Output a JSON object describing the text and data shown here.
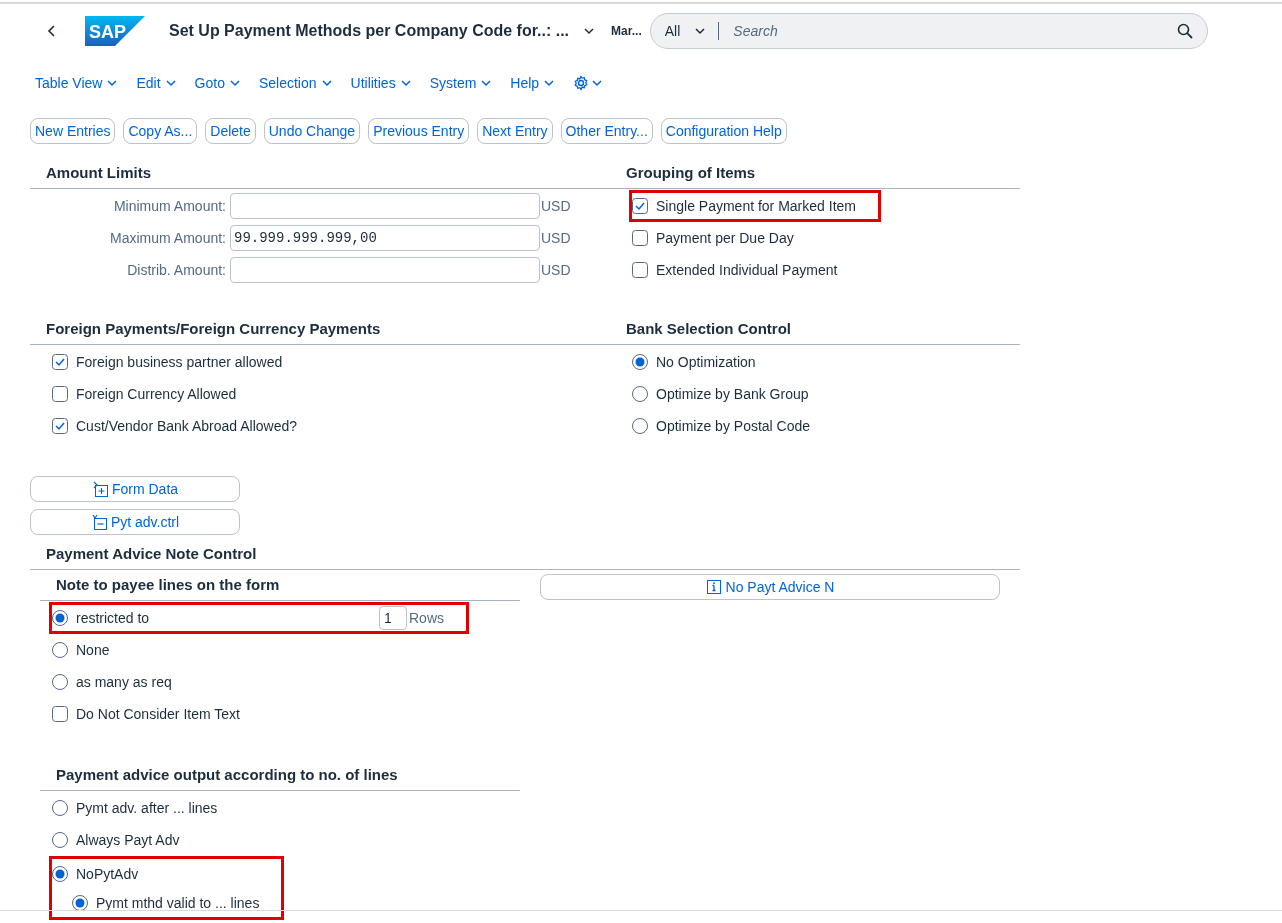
{
  "header": {
    "logo": "SAP",
    "title": "Set Up Payment Methods per Company Code for..: ...",
    "user": "Mar...",
    "search": {
      "scope": "All",
      "placeholder": "Search"
    }
  },
  "menu": [
    "Table View",
    "Edit",
    "Goto",
    "Selection",
    "Utilities",
    "System",
    "Help"
  ],
  "toolbar": [
    "New Entries",
    "Copy As...",
    "Delete",
    "Undo Change",
    "Previous Entry",
    "Next Entry",
    "Other Entry...",
    "Configuration Help"
  ],
  "amount_limits": {
    "title": "Amount Limits",
    "fields": [
      {
        "label": "Minimum Amount:",
        "currency": "USD"
      },
      {
        "label": "Maximum Amount:",
        "value": "99.999.999.999,00",
        "currency": "USD"
      },
      {
        "label": "Distrib. Amount:",
        "currency": "USD"
      }
    ]
  },
  "grouping_of_items": {
    "title": "Grouping of Items",
    "items": [
      {
        "kind": "checkbox",
        "label": "Single Payment for Marked Item",
        "checked": true,
        "highlighted": true
      },
      {
        "kind": "checkbox",
        "label": "Payment per Due Day",
        "checked": false,
        "highlighted": false
      },
      {
        "kind": "checkbox",
        "label": "Extended Individual Payment",
        "checked": false,
        "highlighted": false
      }
    ]
  },
  "foreign_payments": {
    "title": "Foreign Payments/Foreign Currency Payments",
    "items": [
      {
        "kind": "checkbox",
        "label": "Foreign business partner allowed",
        "checked": true,
        "highlighted": false
      },
      {
        "kind": "checkbox",
        "label": "Foreign Currency Allowed",
        "checked": false,
        "highlighted": false
      },
      {
        "kind": "checkbox",
        "label": "Cust/Vendor Bank Abroad Allowed?",
        "checked": true,
        "highlighted": false
      }
    ]
  },
  "bank_selection_control": {
    "title": "Bank Selection Control",
    "items": [
      {
        "kind": "radio",
        "label": "No Optimization",
        "selected": true,
        "highlighted": false
      },
      {
        "kind": "radio",
        "label": "Optimize by Bank Group",
        "selected": false,
        "highlighted": false
      },
      {
        "kind": "radio",
        "label": "Optimize by Postal Code",
        "selected": false,
        "highlighted": false
      }
    ]
  },
  "detail_buttons": [
    {
      "kind": "form",
      "label": "Form Data"
    },
    {
      "kind": "control",
      "label": "Pyt adv.ctrl"
    }
  ],
  "payment_advice_note_control": {
    "title": "Payment Advice Note Control",
    "note_to_payee": {
      "title": "Note to payee lines on the form",
      "items": [
        {
          "kind": "radio",
          "label": "restricted to",
          "selected": true,
          "highlighted": true,
          "value": "1",
          "unit": "Rows"
        },
        {
          "kind": "radio",
          "label": "None",
          "selected": false,
          "highlighted": false
        },
        {
          "kind": "radio",
          "label": "as many as req",
          "selected": false,
          "highlighted": false
        },
        {
          "kind": "checkbox",
          "label": "Do Not Consider Item Text",
          "checked": false,
          "highlighted": false
        }
      ]
    },
    "info_button": "No Payt Advice N",
    "output": {
      "title": "Payment advice output according to no. of lines",
      "items": [
        {
          "kind": "radio",
          "label": "Pymt adv. after ... lines",
          "selected": false,
          "highlighted": false
        },
        {
          "kind": "radio",
          "label": "Always Payt Adv",
          "selected": false,
          "highlighted": false
        },
        {
          "kind": "radio",
          "label": "NoPytAdv",
          "selected": true,
          "highlighted": true,
          "children": [
            {
              "kind": "radio",
              "label": "Pymt mthd valid to ... lines",
              "selected": true,
              "highlighted": false
            }
          ]
        }
      ]
    }
  }
}
